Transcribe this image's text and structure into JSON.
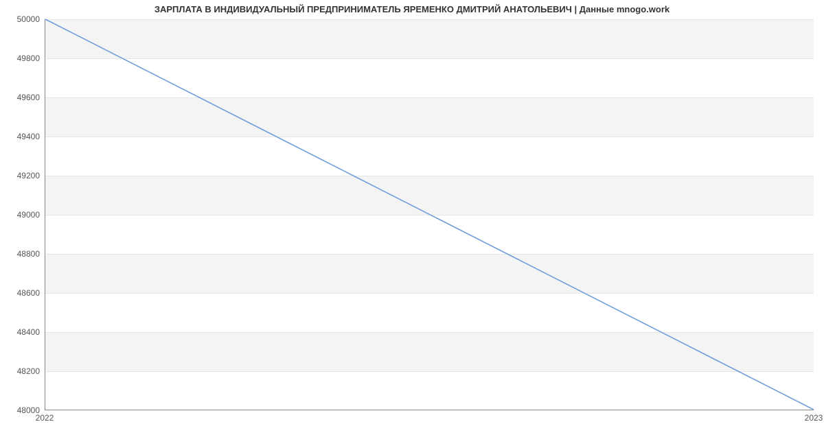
{
  "chart_data": {
    "type": "line",
    "title": "ЗАРПЛАТА В ИНДИВИДУАЛЬНЫЙ ПРЕДПРИНИМАТЕЛЬ ЯРЕМЕНКО ДМИТРИЙ АНАТОЛЬЕВИЧ | Данные mnogo.work",
    "xlabel": "",
    "ylabel": "",
    "x": [
      2022,
      2023
    ],
    "values": [
      50000,
      48000
    ],
    "xlim": [
      2022,
      2023
    ],
    "ylim": [
      48000,
      50000
    ],
    "y_ticks": [
      48000,
      48200,
      48400,
      48600,
      48800,
      49000,
      49200,
      49400,
      49600,
      49800,
      50000
    ],
    "x_ticks": [
      2022,
      2023
    ],
    "line_color": "#6f9edb",
    "band_color": "#f4f4f4"
  }
}
